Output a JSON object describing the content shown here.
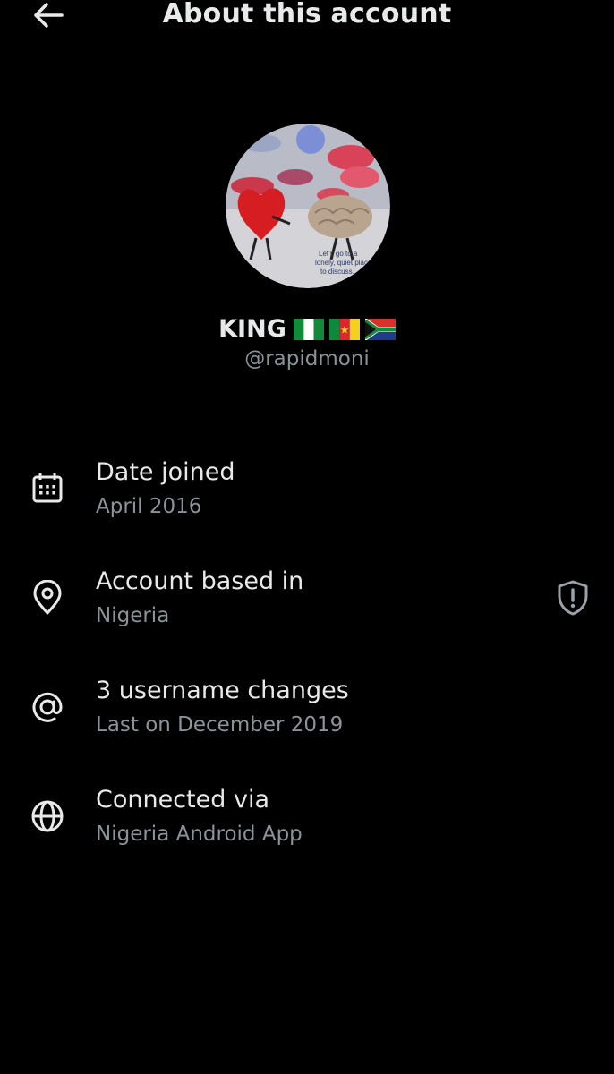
{
  "header": {
    "title": "About this account",
    "back_icon": "arrow-left-icon"
  },
  "profile": {
    "display_name": "KING",
    "flags": [
      "Nigeria",
      "Cameroon",
      "South Africa"
    ],
    "handle": "@rapidmoni",
    "avatar_caption": "Let's go to a lonely, quiet place to discuss."
  },
  "rows": [
    {
      "icon": "calendar-icon",
      "title": "Date joined",
      "subtitle": "April 2016"
    },
    {
      "icon": "location-pin-icon",
      "title": "Account based in",
      "subtitle": "Nigeria",
      "trailing_icon": "shield-exclamation-icon"
    },
    {
      "icon": "at-sign-icon",
      "title": "3 username changes",
      "subtitle": "Last on December 2019"
    },
    {
      "icon": "globe-icon",
      "title": "Connected via",
      "subtitle": "Nigeria Android App"
    }
  ],
  "colors": {
    "background": "#000000",
    "primary_text": "#e7e9ea",
    "secondary_text": "#8b9399"
  }
}
